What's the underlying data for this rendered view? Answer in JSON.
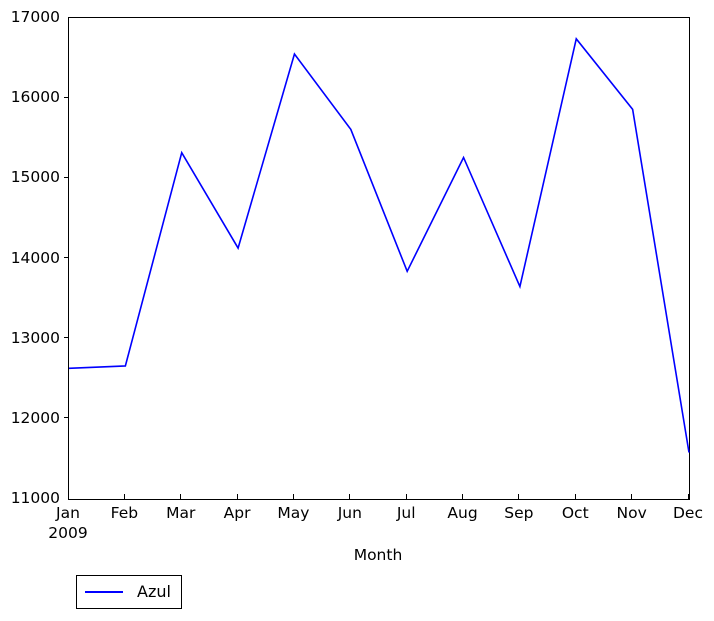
{
  "chart_data": {
    "type": "line",
    "title": "",
    "xlabel": "Month",
    "ylabel": "",
    "categories": [
      "Jan",
      "Feb",
      "Mar",
      "Apr",
      "May",
      "Jun",
      "Jul",
      "Aug",
      "Sep",
      "Oct",
      "Nov",
      "Dec"
    ],
    "x_sublabels": [
      "2009",
      "",
      "",
      "",
      "",
      "",
      "",
      "",
      "",
      "",
      "",
      ""
    ],
    "series": [
      {
        "name": "Azul",
        "color": "#0000ff",
        "values": [
          12630,
          12660,
          15320,
          14130,
          16550,
          15610,
          13840,
          15260,
          13650,
          16740,
          15860,
          11580
        ]
      }
    ],
    "ylim": [
      11000,
      17000
    ],
    "y_ticks": [
      11000,
      12000,
      13000,
      14000,
      15000,
      16000,
      17000
    ],
    "y_tick_labels": [
      "11000",
      "12000",
      "13000",
      "14000",
      "15000",
      "16000",
      "17000"
    ],
    "grid": false,
    "legend_position": "below-left"
  },
  "legend": {
    "entries": [
      {
        "label": "Azul",
        "color": "#0000ff"
      }
    ]
  },
  "axes": {
    "x_title": "Month"
  }
}
